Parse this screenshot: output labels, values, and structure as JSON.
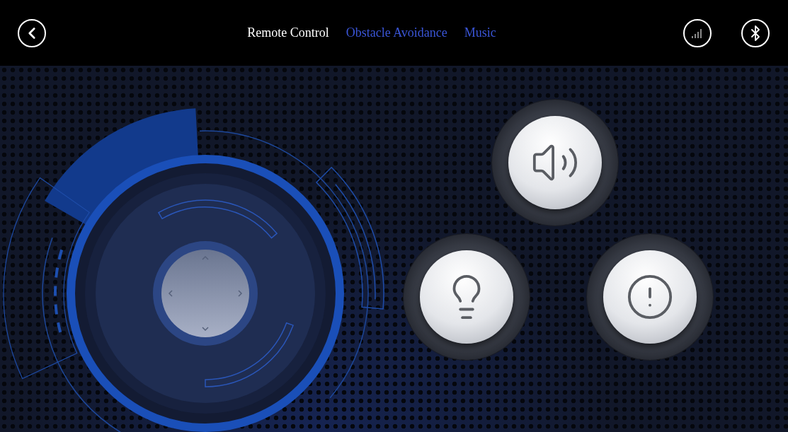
{
  "tabs": [
    {
      "label": "Remote Control",
      "selected": true
    },
    {
      "label": "Obstacle Avoidance",
      "selected": false
    },
    {
      "label": "Music",
      "selected": false
    }
  ],
  "buttons": [
    {
      "kind": "horn"
    },
    {
      "kind": "light"
    },
    {
      "kind": "alert"
    }
  ]
}
